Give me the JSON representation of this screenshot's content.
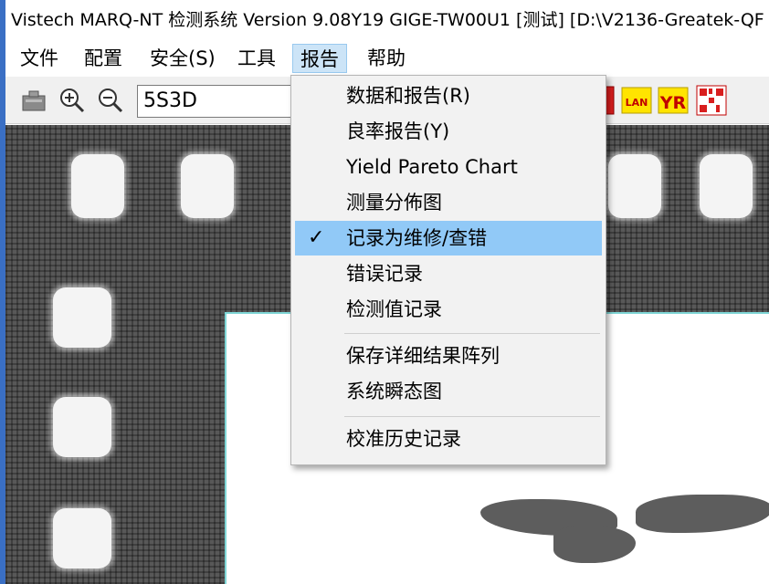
{
  "window": {
    "title": "Vistech MARQ-NT 检测系统 Version 9.08Y19 GIGE-TW00U1 [测试] [D:\\V2136-Greatek-QF"
  },
  "menu_bar": [
    {
      "label": "文件"
    },
    {
      "label": "配置"
    },
    {
      "label": "安全(S)"
    },
    {
      "label": "工具"
    },
    {
      "label": "报告",
      "active": true
    },
    {
      "label": "帮助"
    }
  ],
  "toolbar": {
    "recipe_value": "5S3D",
    "lan_label": "LAN",
    "yr_label": "YR"
  },
  "report_menu": {
    "items": [
      {
        "label": "数据和报告(R)"
      },
      {
        "label": "良率报告(Y)"
      },
      {
        "label": "Yield Pareto Chart"
      },
      {
        "label": "测量分佈图"
      },
      {
        "label": "记录为维修/查错",
        "checked": true
      },
      {
        "label": "错误记录"
      },
      {
        "label": "检测值记录"
      },
      {
        "label": "保存详细结果阵列"
      },
      {
        "label": "系统瞬态图"
      },
      {
        "label": "校准历史记录"
      }
    ],
    "check_glyph": "✓"
  },
  "colors": {
    "highlight": "#91c9f7",
    "menu_active": "#cce4f7",
    "accent_edge": "#3a6fc4"
  }
}
